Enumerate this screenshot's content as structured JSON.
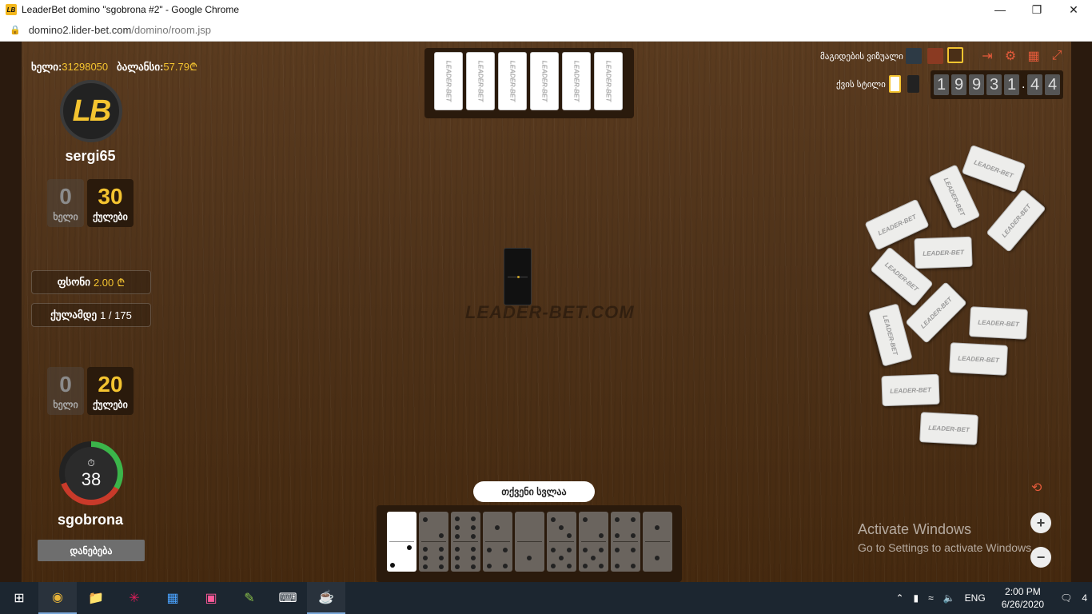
{
  "window": {
    "title": "LeaderBet domino \"sgobrona #2\" - Google Chrome",
    "icon_text": "LB",
    "controls": [
      "minimize",
      "restore",
      "close"
    ]
  },
  "address": {
    "host": "domino2.lider-bet.com",
    "path": "/domino/room.jsp"
  },
  "header": {
    "hand_label": "ხელი:",
    "hand_value": "31298050",
    "balance_label": "ბალანსი:",
    "balance_value": "57.79",
    "currency": "₾"
  },
  "opponent": {
    "avatar_text": "LB",
    "name": "sergi65",
    "hand_score": "0",
    "hand_label": "ხელი",
    "points": "30",
    "points_label": "ქულები",
    "tiles_count": 6,
    "tile_text": "LEADER-BET"
  },
  "info": {
    "stake_label": "ფსონი",
    "stake_value": "2.00",
    "target_label": "ქულამდე",
    "target_value": "1 / 175"
  },
  "player": {
    "hand_score": "0",
    "hand_label": "ხელი",
    "points": "20",
    "points_label": "ქულები",
    "timer": "38",
    "name": "sgobrona",
    "leave_label": "დანებება"
  },
  "center": {
    "watermark": "LEADER-BET.COM"
  },
  "right_panel": {
    "table_design_label": "მაგიდების ვიზუალი",
    "bone_table_label": "ქვის სტილი",
    "counter_digits": [
      "1",
      "9",
      "9",
      "3",
      "1",
      "4",
      "4"
    ],
    "counter_separator": ".",
    "bone_text": "LEADER-BET"
  },
  "turn": {
    "label": "თქვენი სვლაა"
  },
  "hand_tiles": [
    {
      "top": [],
      "bottom": [
        1,
        1
      ],
      "active": true
    },
    {
      "top": [
        2
      ],
      "bottom": [
        6
      ]
    },
    {
      "top": [
        6
      ],
      "bottom": [
        6
      ]
    },
    {
      "top": [
        1
      ],
      "bottom": [
        4
      ]
    },
    {
      "top": [
        0
      ],
      "bottom": [
        1
      ]
    },
    {
      "top": [
        3
      ],
      "bottom": [
        5
      ]
    },
    {
      "top": [
        2
      ],
      "bottom": [
        5
      ]
    },
    {
      "top": [
        4
      ],
      "bottom": [
        4
      ]
    },
    {
      "top": [
        1
      ],
      "bottom": [
        1
      ]
    }
  ],
  "overlay": {
    "activate_title": "Activate Windows",
    "activate_sub": "Go to Settings to activate Windows."
  },
  "taskbar": {
    "apps": [
      "windows-start",
      "chrome",
      "file-explorer",
      "slack",
      "excel-like",
      "intellij",
      "notepad",
      "terminal",
      "java"
    ],
    "lang": "ENG",
    "time": "2:00 PM",
    "date": "6/26/2020",
    "notifications": "4"
  }
}
